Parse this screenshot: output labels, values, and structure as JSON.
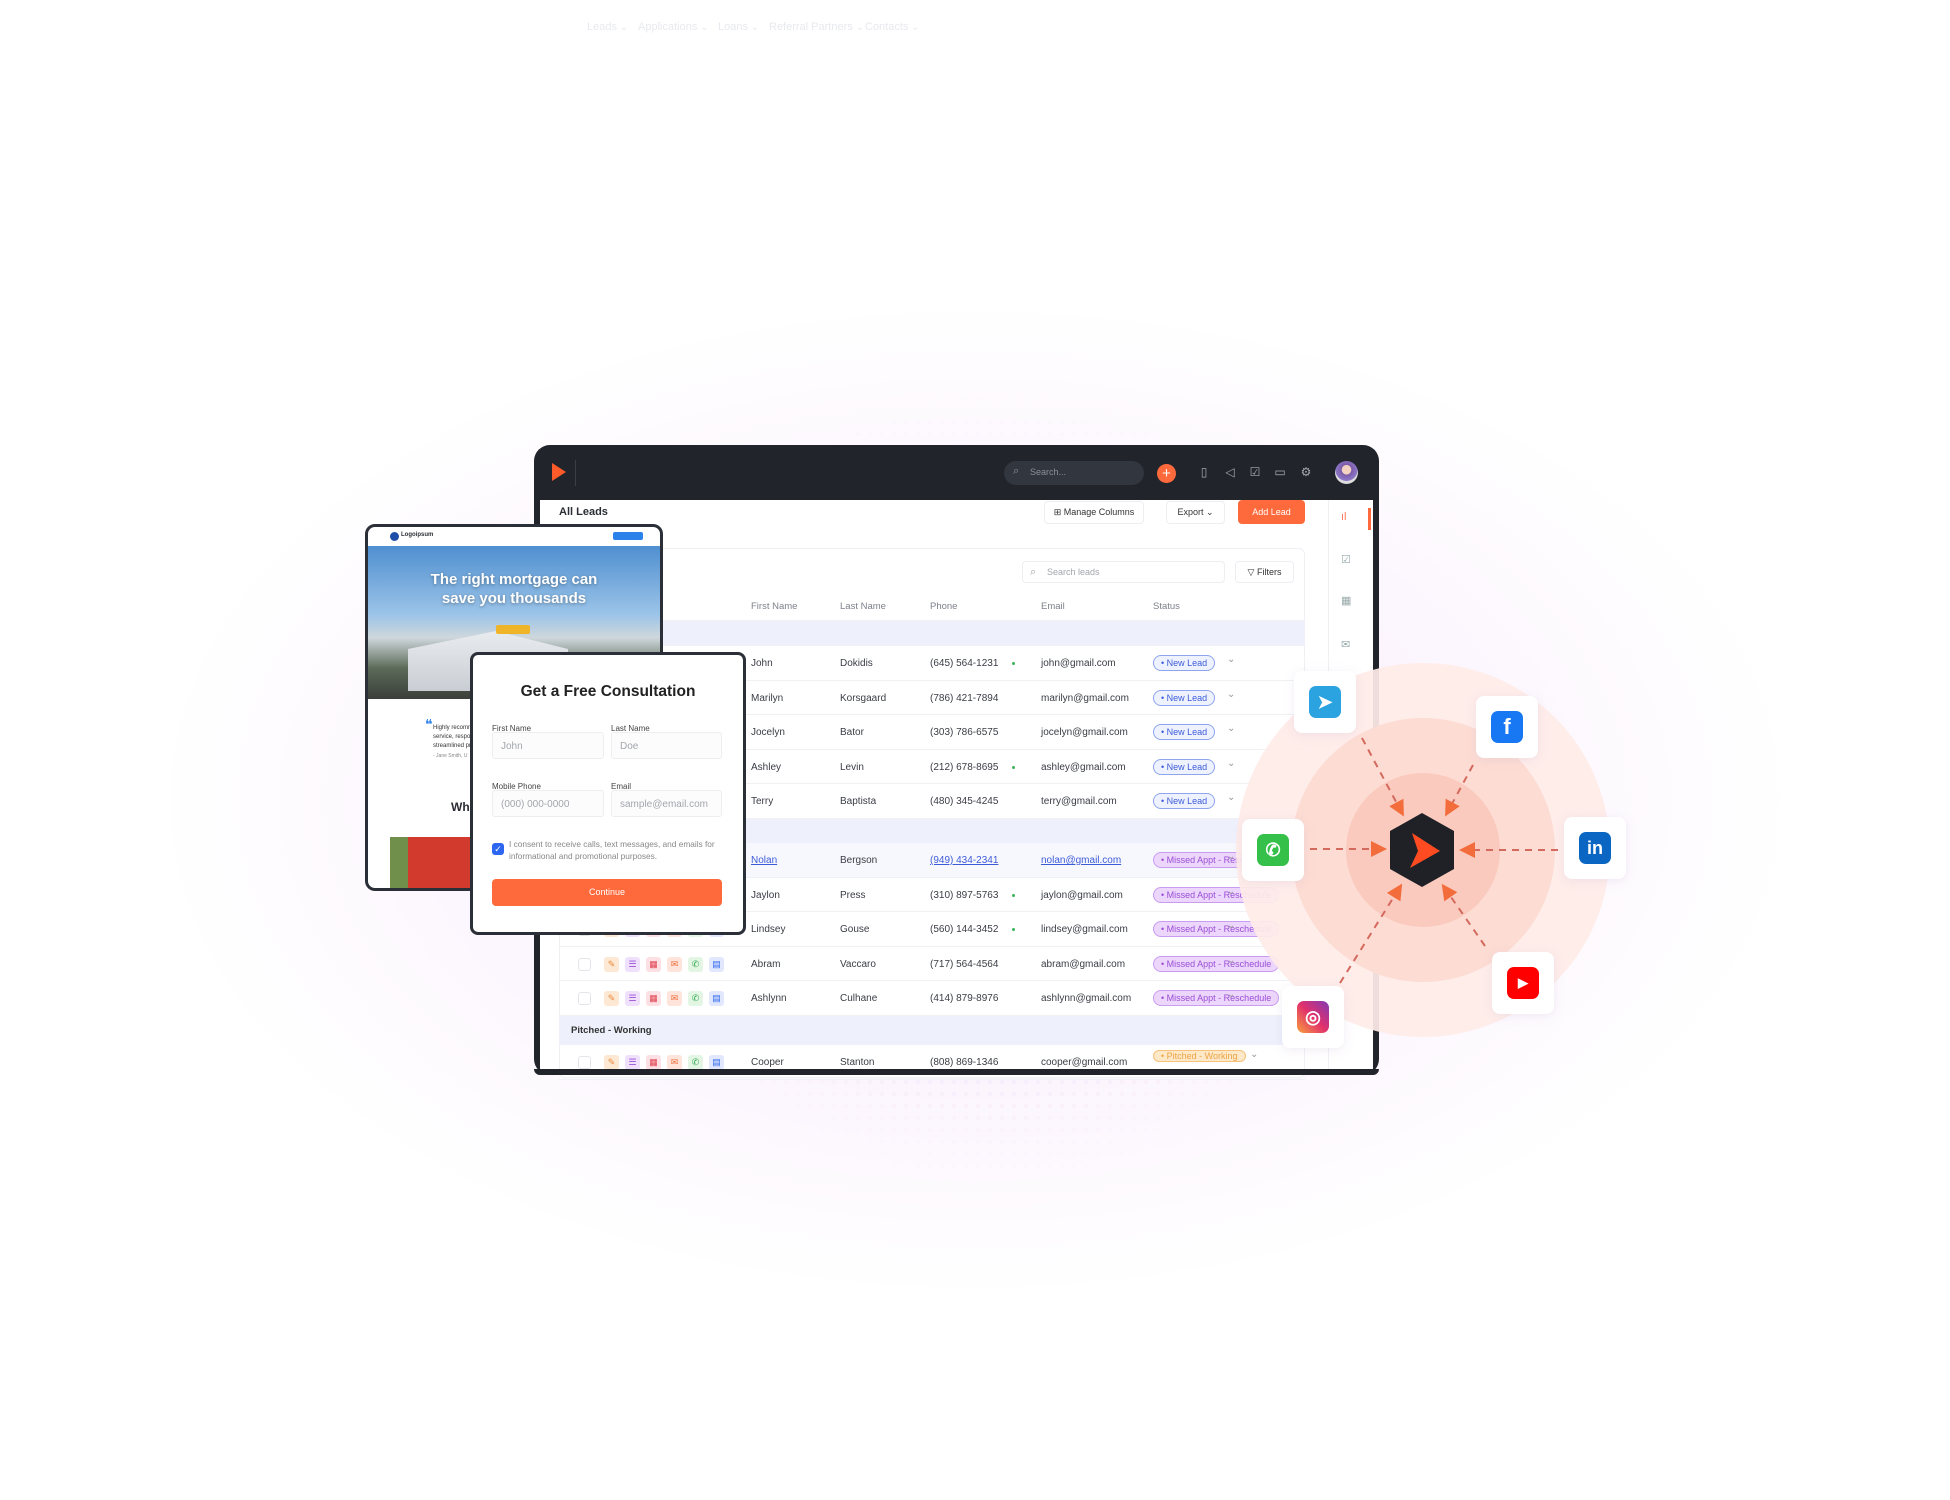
{
  "colors": {
    "accent": "#ff6a3d",
    "nav_bg": "#21242b",
    "new_lead": "#3d5bd8",
    "missed": "#9a4ed6",
    "pitched": "#eea344"
  },
  "nav": {
    "items": [
      "Leads",
      "Applications",
      "Loans",
      "Referral Partners",
      "Contacts"
    ],
    "search_placeholder": "Search...",
    "icons": [
      "document-chart-icon",
      "megaphone-icon",
      "checklist-icon",
      "monitor-icon",
      "gear-icon"
    ]
  },
  "page": {
    "title": "All Leads",
    "manage_columns": "Manage Columns",
    "export": "Export",
    "add_lead": "Add Lead",
    "search_placeholder": "Search leads",
    "filters": "Filters"
  },
  "columns": [
    "First Name",
    "Last Name",
    "Phone",
    "Email",
    "Status"
  ],
  "groups": [
    {
      "label": "",
      "rows": [
        {
          "first": "John",
          "last": "Dokidis",
          "phone": "(645) 564-1231",
          "online": true,
          "email": "john@gmail.com",
          "status": "New Lead",
          "type": "new"
        },
        {
          "first": "Marilyn",
          "last": "Korsgaard",
          "phone": "(786) 421-7894",
          "online": false,
          "email": "marilyn@gmail.com",
          "status": "New Lead",
          "type": "new"
        },
        {
          "first": "Jocelyn",
          "last": "Bator",
          "phone": "(303) 786-6575",
          "online": false,
          "email": "jocelyn@gmail.com",
          "status": "New Lead",
          "type": "new"
        },
        {
          "first": "Ashley",
          "last": "Levin",
          "phone": "(212) 678-8695",
          "online": true,
          "email": "ashley@gmail.com",
          "status": "New Lead",
          "type": "new"
        },
        {
          "first": "Terry",
          "last": "Baptista",
          "phone": "(480) 345-4245",
          "online": false,
          "email": "terry@gmail.com",
          "status": "New Lead",
          "type": "new"
        }
      ]
    },
    {
      "label": "",
      "rows": [
        {
          "first": "Nolan",
          "last": "Bergson",
          "phone": "(949) 434-2341",
          "online": false,
          "email": "nolan@gmail.com",
          "status": "Missed Appt - Reschedule",
          "type": "missed",
          "link": true
        },
        {
          "first": "Jaylon",
          "last": "Press",
          "phone": "(310) 897-5763",
          "online": true,
          "email": "jaylon@gmail.com",
          "status": "Missed Appt - Reschedule",
          "type": "missed"
        },
        {
          "first": "Lindsey",
          "last": "Gouse",
          "phone": "(560) 144-3452",
          "online": true,
          "email": "lindsey@gmail.com",
          "status": "Missed Appt - Reschedule",
          "type": "missed"
        },
        {
          "first": "Abram",
          "last": "Vaccaro",
          "phone": "(717) 564-4564",
          "online": false,
          "email": "abram@gmail.com",
          "status": "Missed Appt - Reschedule",
          "type": "missed"
        },
        {
          "first": "Ashlynn",
          "last": "Culhane",
          "phone": "(414) 879-8976",
          "online": false,
          "email": "ashlynn@gmail.com",
          "status": "Missed Appt - Reschedule",
          "type": "missed"
        }
      ]
    },
    {
      "label": "Pitched - Working",
      "rows": [
        {
          "first": "Cooper",
          "last": "Stanton",
          "phone": "(808) 869-1346",
          "online": false,
          "email": "cooper@gmail.com",
          "status": "Pitched - Working",
          "type": "pitched"
        }
      ]
    }
  ],
  "landing": {
    "logo": "Logoipsum",
    "headline_1": "The right mortgage can",
    "headline_2": "save you thousands",
    "quote": "Highly recomm service, respo streamlined pr",
    "author": "- Jane Smith, U",
    "section": "Wha"
  },
  "form": {
    "title": "Get a Free Consultation",
    "first_label": "First Name",
    "first_ph": "John",
    "last_label": "Last Name",
    "last_ph": "Doe",
    "phone_label": "Mobile Phone",
    "phone_ph": "(000) 000-0000",
    "email_label": "Email",
    "email_ph": "sample@email.com",
    "consent": "I consent to receive calls, text messages, and emails for informational and promotional purposes.",
    "consent_checked": true,
    "submit": "Continue"
  },
  "integrations": [
    "telegram",
    "facebook",
    "whatsapp",
    "linkedin",
    "instagram",
    "youtube"
  ]
}
